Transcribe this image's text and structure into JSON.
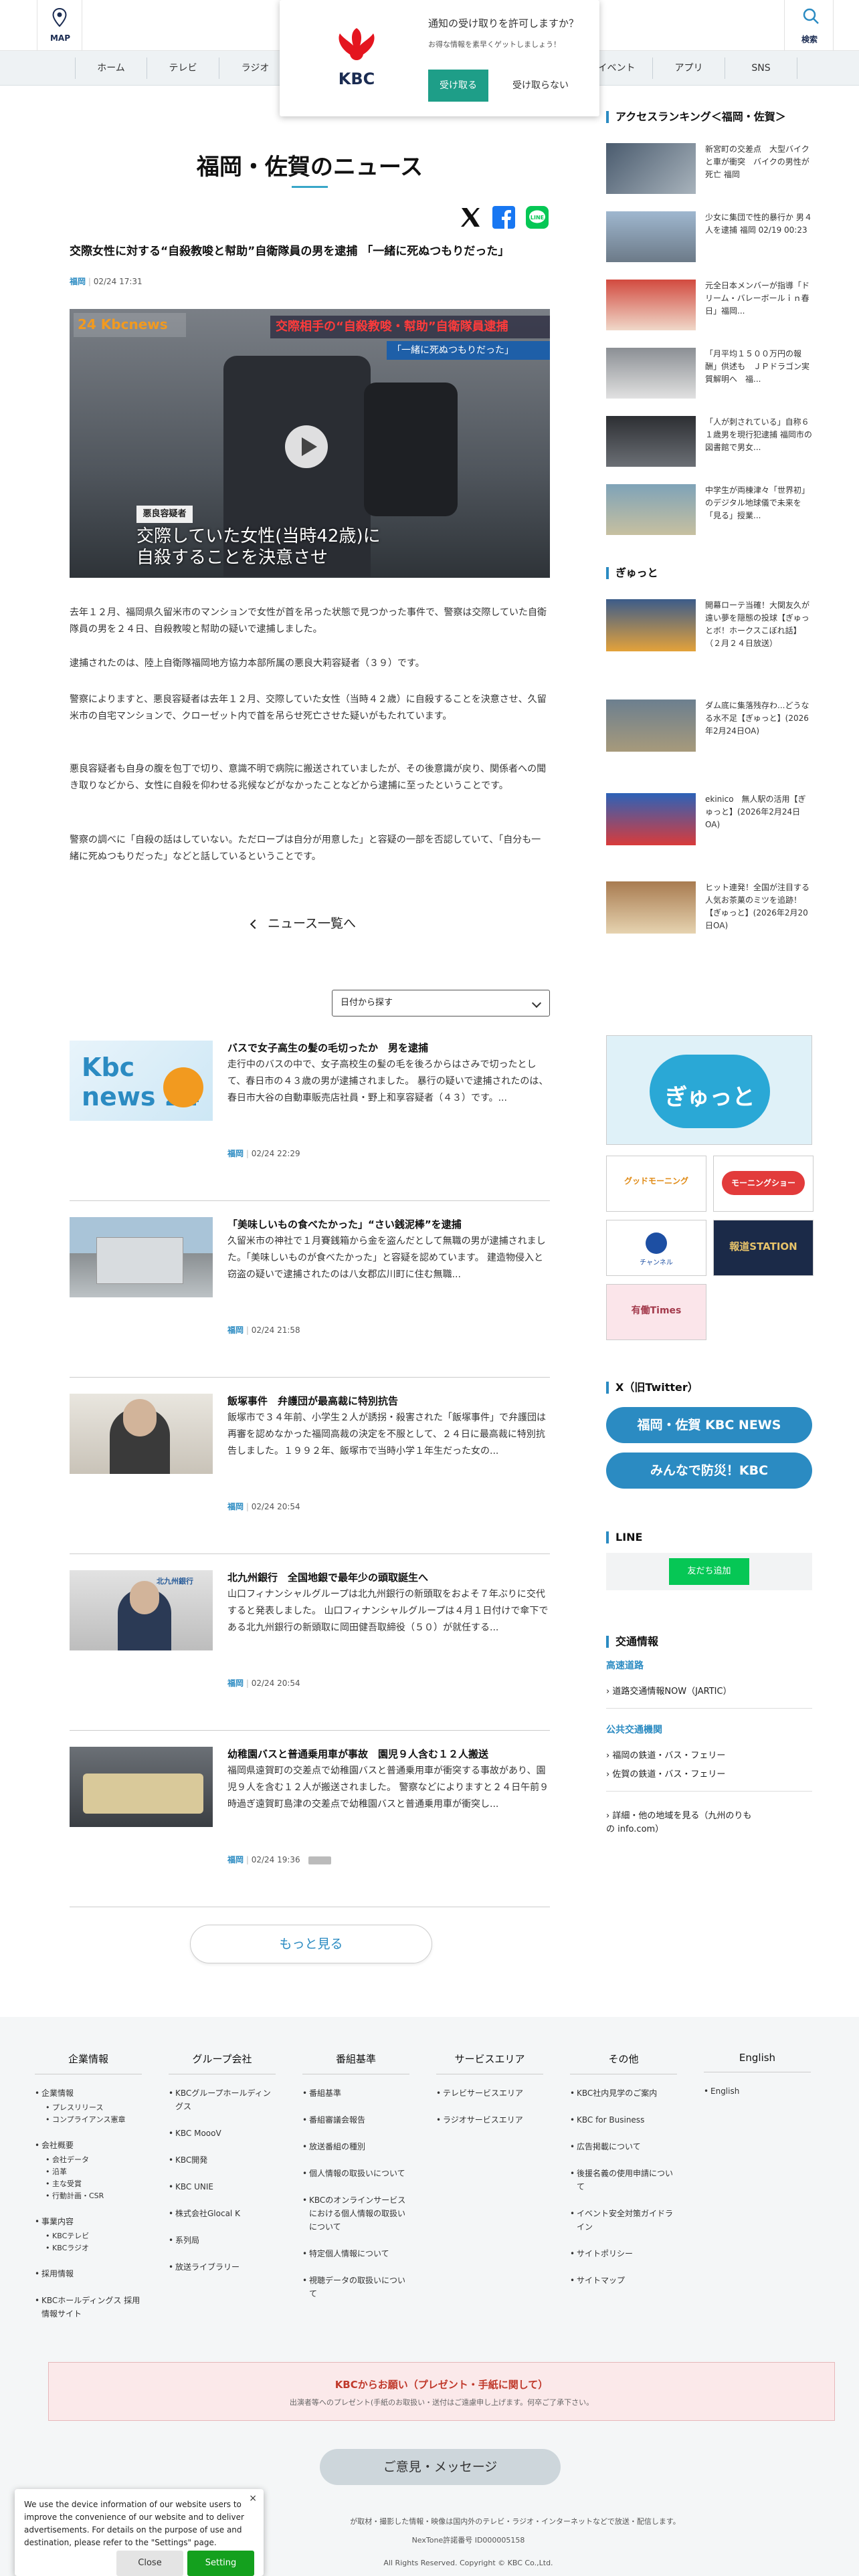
{
  "header": {
    "map_label": "MAP",
    "search_label": "検索",
    "nav": [
      "ホーム",
      "テレビ",
      "ラジオ",
      "",
      "",
      "",
      "",
      "イベント",
      "アプリ",
      "SNS"
    ]
  },
  "notify": {
    "title": "通知の受け取りを許可しますか？",
    "sub": "お得な情報を素早くゲットしましょう！",
    "accept": "受け取る",
    "decline": "受け取らない",
    "logo_text": "KBC"
  },
  "article": {
    "page_title": "福岡・佐賀のニュース",
    "headline": "交際女性に対する“自殺教唆と幇助”自衛隊員の男を逮捕 「一緒に死ぬつもりだった」",
    "category": "福岡",
    "date": "02/24 17:31",
    "hero_logo": "24 Kbcnews",
    "hero_banner": "交際相手の“自殺教唆・幇助”自衛隊員逮捕",
    "hero_quote": "「一緒に死ぬつもりだった」",
    "hero_tag": "悪良容疑者",
    "hero_caption1": "交際していた女性(当時42歳)に",
    "hero_caption2": "自殺することを決意させ",
    "paragraphs": [
      "去年１２月、福岡県久留米市のマンションで女性が首を吊った状態で見つかった事件で、警察は交際していた自衛隊員の男を２４日、自殺教唆と幇助の疑いで逮捕しました。",
      "逮捕されたのは、陸上自衛隊福岡地方協力本部所属の悪良大莉容疑者（３９）です。",
      "警察によりますと、悪良容疑者は去年１２月、交際していた女性（当時４２歳）に自殺することを決意させ、久留米市の自宅マンションで、クローゼット内で首を吊らせ死亡させた疑いがもたれています。",
      "悪良容疑者も自身の腹を包丁で切り、意識不明で病院に搬送されていましたが、その後意識が戻り、関係者への聞き取りなどから、女性に自殺を仰わせる兆候などがなかったことなどから逮捕に至ったということです。",
      "警察の調べに「自殺の話はしていない。ただロープは自分が用意した」と容疑の一部を否認していて、「自分も一緒に死ぬつもりだった」などと話しているということです。"
    ],
    "back_label": "ニュース一覧へ"
  },
  "list": {
    "date_select": "日付から探す",
    "items": [
      {
        "title": "バスで女子高生の髪の毛切ったか　男を逮捕",
        "desc": "走行中のバスの中で、女子高校生の髪の毛を後ろからはさみで切ったとして、春日市の４３歳の男が逮捕されました。 暴行の疑いで逮捕されたのは、春日市大谷の自動車販売店社員・野上和享容疑者（４３）です。...",
        "cat": "福岡",
        "date": "02/24 22:29",
        "thumb_text": "Kbc news 24"
      },
      {
        "title": "「美味しいもの食べたかった」“さい銭泥棒”を逮捕",
        "desc": "久留米市の神社で１月賽銭箱から金を盗んだとして無職の男が逮捕されました。「美味しいものが食べたかった」と容疑を認めています。 建造物侵入と窃盗の疑いで逮捕されたのは八女郡広川町に住む無職...",
        "cat": "福岡",
        "date": "02/24 21:58",
        "thumb_text": ""
      },
      {
        "title": "飯塚事件　弁護団が最高裁に特別抗告",
        "desc": "飯塚市で３４年前、小学生２人が誘拐・殺害された「飯塚事件」で弁護団は再審を認めなかった福岡高裁の決定を不服として、２４日に最高裁に特別抗告しました。１９９２年、飯塚市で当時小学１年生だった女の...",
        "cat": "福岡",
        "date": "02/24 20:54",
        "thumb_text": ""
      },
      {
        "title": "北九州銀行　全国地銀で最年少の頭取誕生へ",
        "desc": "山口フィナンシャルグループは北九州銀行の新頭取をおよそ７年ぶりに交代すると発表しました。 山口フィナンシャルグループは４月１日付けで傘下である北九州銀行の新頭取に岡田健吾取締役（５０）が就任する...",
        "cat": "福岡",
        "date": "02/24 20:54",
        "thumb_text": "北九州銀行"
      },
      {
        "title": "幼稚園バスと普通乗用車が事故　園児９人含む１２人搬送",
        "desc": "福岡県遠賀町の交差点で幼稚園バスと普通乗用車が衝突する事故があり、園児９人を含む１２人が搬送されました。 警察などによりますと２４日午前９時過ぎ遠賀町島津の交差点で幼稚園バスと普通乗用車が衝突し...",
        "cat": "福岡",
        "date": "02/24 19:36",
        "thumb_text": ""
      }
    ],
    "more_label": "もっと見る"
  },
  "sidebar": {
    "ranking_title": "アクセスランキング＜福岡・佐賀＞",
    "ranking": [
      "新宮町の交差点　大型バイクと車が衝突　バイクの男性が死亡 福岡",
      "少女に集団で性的暴行か 男４人を逮捕 福岡 02/19 00:23",
      "元全日本メンバーが指導「ドリーム・バレーボールｉｎ春日」福岡...",
      "「月平均１５００万円の報酬」供述も　ＪＰドラゴン実質解明へ　福...",
      "「人が刺されている」自称６１歳男を現行犯逮捕 福岡市の図書館で男女...",
      "中学生が両棟津々「世界初」のデジタル地球儀で未来を「見る」授業..."
    ],
    "gyutto_title": "ぎゅっと",
    "gyutto": [
      "開幕ローテ当確！大関友久が遠い夢を隠態の投球【ぎゅっとボ！ホークスこぼれ話】（２月２４日放送）",
      "ダム底に集落残存わ...どうなる水不足【ぎゅっと】(2026年2月24日OA)",
      "ekinico　無人駅の活用【ぎゅっと】(2026年2月24日OA)",
      "ヒット連発！全国が注目する人気お茶菓のミツを追跡！【ぎゅっと】(2026年2月20日OA)"
    ],
    "banner_big": "ぎゅっと",
    "banners": [
      "グッドモーニング",
      "モーニングショー",
      "チャンネル",
      "報道STATION",
      "有働Times"
    ],
    "x_title": "X（旧Twitter）",
    "x_buttons": [
      "福岡・佐賀 KBC NEWS",
      "みんなで防災！KBC"
    ],
    "line_title": "LINE",
    "line_button": "友だち追加",
    "traffic_title": "交通情報",
    "traffic_highway": "高速道路",
    "traffic_highway_link": "道路交通情報NOW（JARTIC）",
    "traffic_public": "公共交通機関",
    "traffic_public_links": [
      "福岡の鉄道・バス・フェリー",
      "佐賀の鉄道・バス・フェリー"
    ],
    "traffic_other": "詳細・他の地域を見る（九州のりもの info.com）"
  },
  "footer": {
    "columns": [
      {
        "title": "企業情報",
        "items": [
          {
            "t": "企業情報",
            "c": "grp"
          },
          {
            "t": "プレスリリース",
            "c": "sub"
          },
          {
            "t": "コンプライアンス憲章",
            "c": "sub grp-end"
          },
          {
            "t": "会社概要",
            "c": "grp"
          },
          {
            "t": "会社データ",
            "c": "sub"
          },
          {
            "t": "沿革",
            "c": "sub"
          },
          {
            "t": "主な受賞",
            "c": "sub"
          },
          {
            "t": "行動計画・CSR",
            "c": "sub grp-end"
          },
          {
            "t": "事業内容",
            "c": "grp"
          },
          {
            "t": "KBCテレビ",
            "c": "sub"
          },
          {
            "t": "KBCラジオ",
            "c": "sub grp-end"
          },
          {
            "t": "採用情報",
            "c": ""
          },
          {
            "t": "KBCホールディングス 採用情報サイト",
            "c": ""
          }
        ]
      },
      {
        "title": "グループ会社",
        "items": [
          {
            "t": "KBCグループホールディングス",
            "c": ""
          },
          {
            "t": "KBC MoooV",
            "c": ""
          },
          {
            "t": "KBC開発",
            "c": ""
          },
          {
            "t": "KBC UNIE",
            "c": ""
          },
          {
            "t": "株式会社Glocal K",
            "c": ""
          },
          {
            "t": "系列局",
            "c": ""
          },
          {
            "t": "放送ライブラリー",
            "c": ""
          }
        ]
      },
      {
        "title": "番組基準",
        "items": [
          {
            "t": "番組基準",
            "c": ""
          },
          {
            "t": "番組審議会報告",
            "c": ""
          },
          {
            "t": "放送番組の種別",
            "c": ""
          },
          {
            "t": "個人情報の取扱いについて",
            "c": ""
          },
          {
            "t": "KBCのオンラインサービスにおける個人情報の取扱いについて",
            "c": ""
          },
          {
            "t": "特定個人情報について",
            "c": ""
          },
          {
            "t": "視聴データの取扱いについて",
            "c": ""
          }
        ]
      },
      {
        "title": "サービスエリア",
        "items": [
          {
            "t": "テレビサービスエリア",
            "c": ""
          },
          {
            "t": "ラジオサービスエリア",
            "c": ""
          }
        ]
      },
      {
        "title": "その他",
        "items": [
          {
            "t": "KBC社内見学のご案内",
            "c": ""
          },
          {
            "t": "KBC for Business",
            "c": ""
          },
          {
            "t": "広告掲載について",
            "c": ""
          },
          {
            "t": "後援名義の使用申請について",
            "c": ""
          },
          {
            "t": "イベント安全対策ガイドライン",
            "c": ""
          },
          {
            "t": "サイトポリシー",
            "c": ""
          },
          {
            "t": "サイトマップ",
            "c": ""
          }
        ]
      },
      {
        "title": "English",
        "items": [
          {
            "t": "English",
            "c": ""
          }
        ]
      }
    ],
    "present_title": "KBCからお願い（プレゼント・手紙に関して）",
    "present_sub": "出演者等へのプレゼント(手紙のお取扱い・送付はご遠慮申し上げます。何卒ご了承下さい。",
    "opinion": "ご意見・メッセージ",
    "copy1": "が取材・撮影した情報・映像は国内外のテレビ・ラジオ・インターネットなどで放送・配信します。",
    "copy2": "NexTone許諾番号 ID000005158",
    "copy3": "All Rights Reserved. Copyright © KBC Co.,Ltd."
  },
  "cookie": {
    "message": "We use the device information of our website users to improve the convenience of our website and to deliver advertisements. For details on the purpose of use and destination, please refer to the \"Settings\" page.",
    "close": "Close",
    "setting": "Setting"
  },
  "colors": {
    "accent": "#2b8bc2",
    "teal": "#1e9e88",
    "line_green": "#06c755",
    "cookie_green": "#14a01e"
  }
}
